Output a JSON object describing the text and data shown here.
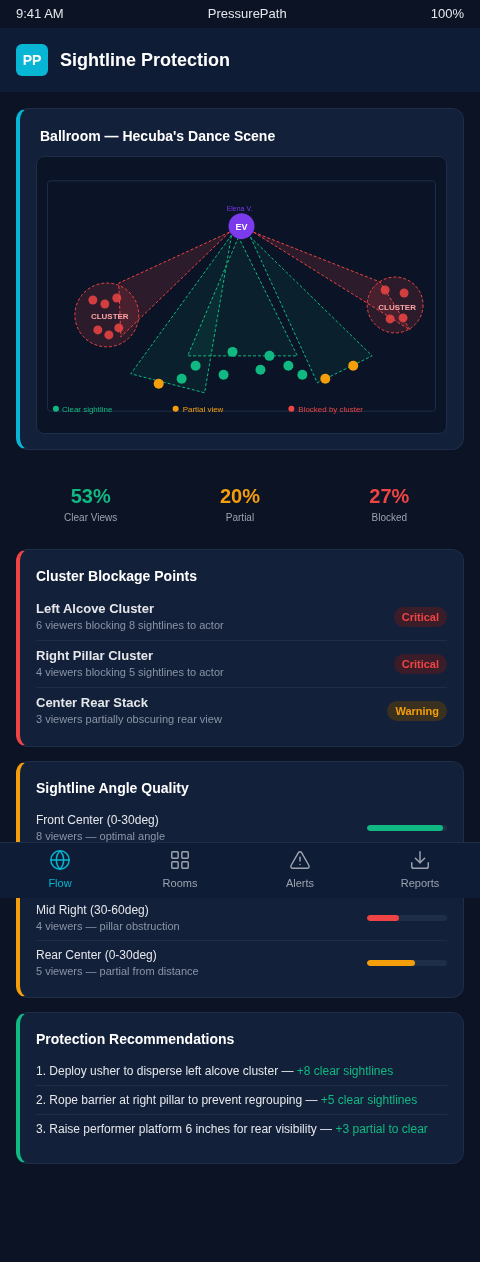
{
  "status_bar": {
    "time": "9:41 AM",
    "app": "PressurePath",
    "battery": "100%"
  },
  "header": {
    "logo": "PP",
    "title": "Sightline Protection"
  },
  "venue_card": {
    "title": "Ballroom — Hecuba's Dance Scene",
    "actor": {
      "name": "Elena V.",
      "initials": "EV"
    },
    "cluster_labels": [
      "CLUSTER",
      "CLUSTER"
    ],
    "legend": [
      {
        "label": "Clear sightline",
        "color": "#10b981"
      },
      {
        "label": "Partial view",
        "color": "#f59e0b"
      },
      {
        "label": "Blocked by cluster",
        "color": "#ef4444"
      }
    ]
  },
  "stats": [
    {
      "value": "53%",
      "label": "Clear Views",
      "color": "#10b981"
    },
    {
      "value": "20%",
      "label": "Partial",
      "color": "#f59e0b"
    },
    {
      "value": "27%",
      "label": "Blocked",
      "color": "#ef4444"
    }
  ],
  "blockage": {
    "title": "Cluster Blockage Points",
    "items": [
      {
        "name": "Left Alcove Cluster",
        "detail": "6 viewers blocking 8 sightlines to actor",
        "badge": "Critical",
        "kind": "critical"
      },
      {
        "name": "Right Pillar Cluster",
        "detail": "4 viewers blocking 5 sightlines to actor",
        "badge": "Critical",
        "kind": "critical"
      },
      {
        "name": "Center Rear Stack",
        "detail": "3 viewers partially obscuring rear view",
        "badge": "Warning",
        "kind": "warning"
      }
    ]
  },
  "angles": {
    "title": "Sightline Angle Quality",
    "items": [
      {
        "name": "Front Center (0-30deg)",
        "detail": "8 viewers — optimal angle",
        "level": 0.95,
        "color": "#10b981"
      },
      {
        "name": "Mid Right (30-60deg)",
        "detail": "4 viewers — pillar obstruction",
        "level": 0.4,
        "color": "#ef4444"
      },
      {
        "name": "Rear Center (0-30deg)",
        "detail": "5 viewers — partial from distance",
        "level": 0.6,
        "color": "#f59e0b"
      }
    ]
  },
  "recommendations": {
    "title": "Protection Recommendations",
    "items": [
      {
        "text": "1. Deploy usher to disperse left alcove cluster —",
        "gain": "+8 clear sightlines"
      },
      {
        "text": "2. Rope barrier at right pillar to prevent regrouping —",
        "gain": "+5 clear sightlines"
      },
      {
        "text": "3. Raise performer platform 6 inches for rear visibility —",
        "gain": "+3 partial to clear"
      }
    ]
  },
  "bottom_nav": [
    {
      "label": "Flow",
      "selected": true
    },
    {
      "label": "Rooms",
      "selected": false
    },
    {
      "label": "Alerts",
      "selected": false
    },
    {
      "label": "Reports",
      "selected": false
    }
  ]
}
